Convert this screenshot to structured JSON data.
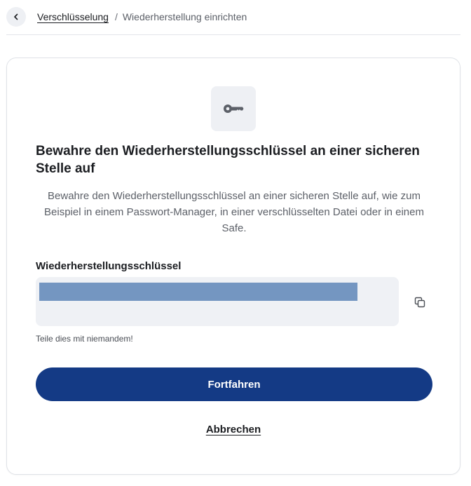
{
  "breadcrumb": {
    "back_icon": "chevron-left-icon",
    "parent": "Verschlüsselung",
    "separator": "/",
    "current": "Wiederherstellung einrichten"
  },
  "card": {
    "icon": "key-icon",
    "title": "Bewahre den Wiederherstellungsschlüssel an einer sicheren Stelle auf",
    "description": "Bewahre den Wiederherstellungsschlüssel an einer sicheren Stelle auf, wie zum Beispiel in einem Passwort-Manager, in einer verschlüsselten Datei oder in einem Safe.",
    "field_label": "Wiederherstellungsschlüssel",
    "copy_icon": "copy-icon",
    "hint": "Teile dies mit niemandem!",
    "continue_label": "Fortfahren",
    "cancel_label": "Abbrechen"
  },
  "colors": {
    "primary": "#143a85",
    "redaction": "#7496c1",
    "field_bg": "#eff1f5"
  }
}
